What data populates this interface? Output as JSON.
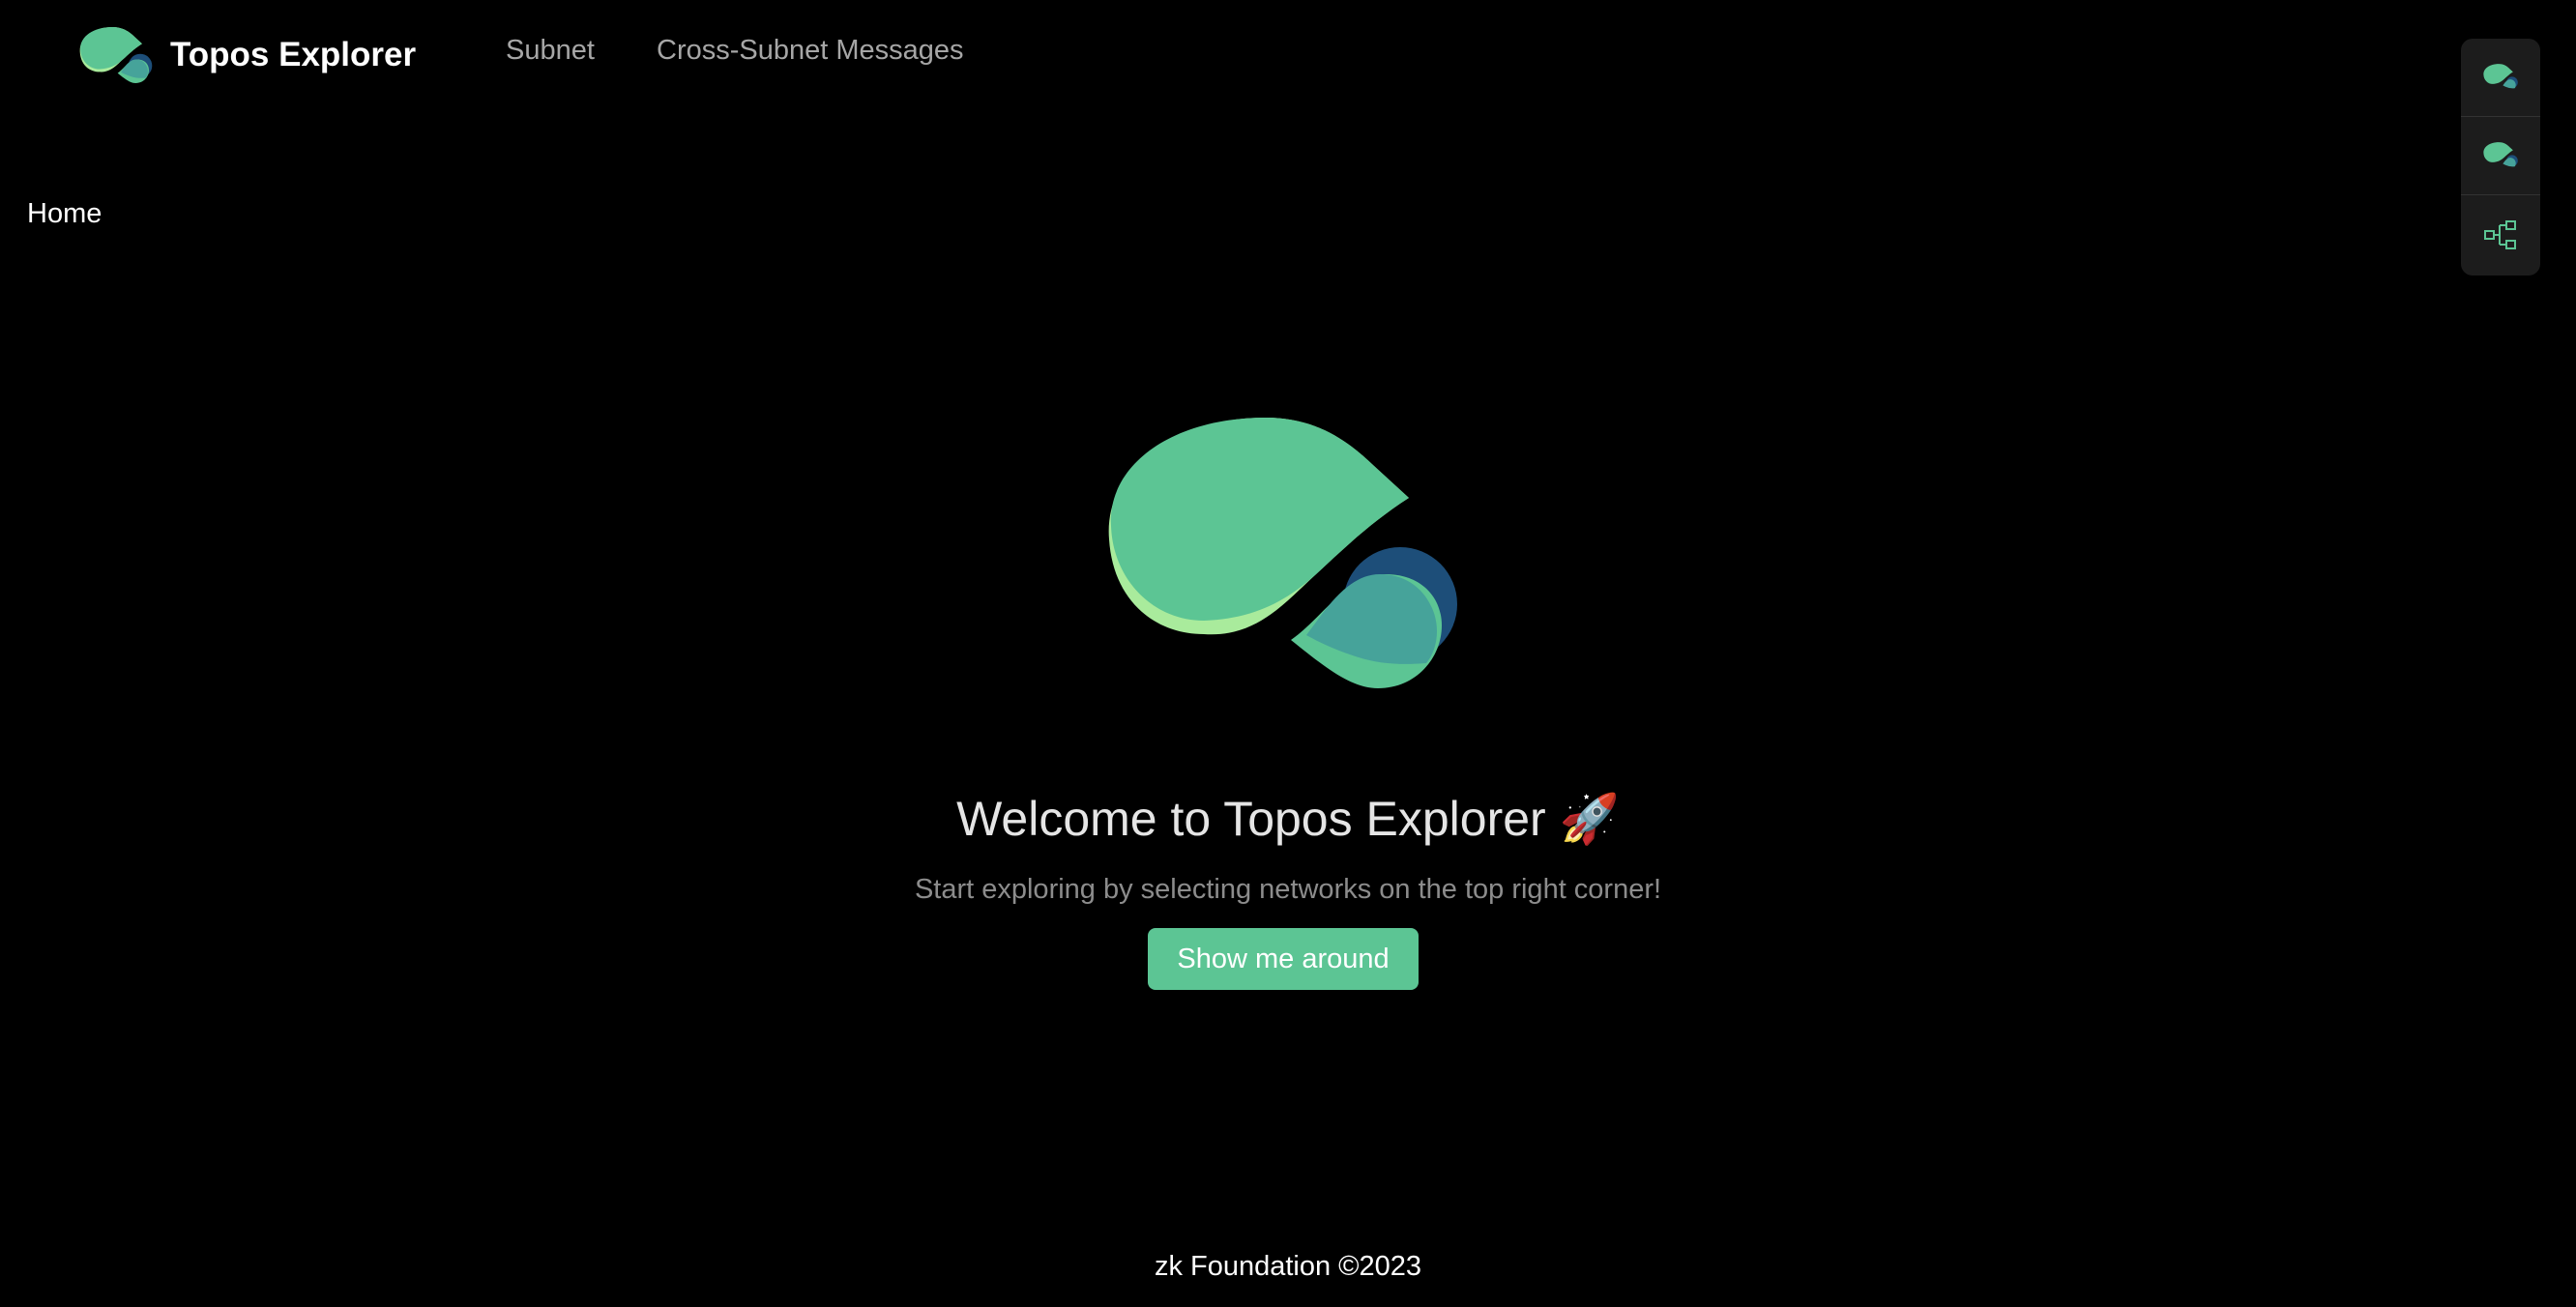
{
  "header": {
    "app_title": "Topos Explorer",
    "nav": [
      {
        "label": "Subnet"
      },
      {
        "label": "Cross-Subnet Messages"
      }
    ]
  },
  "breadcrumb": {
    "current": "Home"
  },
  "network_panel": {
    "buttons": [
      {
        "icon": "topos-logo-icon"
      },
      {
        "icon": "topos-logo-icon"
      },
      {
        "icon": "subnet-tree-icon"
      }
    ]
  },
  "main": {
    "welcome_title": "Welcome to Topos Explorer 🚀",
    "subtitle": "Start exploring by selecting networks on the top right corner!",
    "cta_label": "Show me around"
  },
  "footer": {
    "text": "zk Foundation ©2023"
  },
  "colors": {
    "background": "#000000",
    "accent_green": "#5cc594",
    "light_green": "#a9eb9c",
    "dark_blue": "#1d4e79",
    "teal": "#46a39a"
  }
}
